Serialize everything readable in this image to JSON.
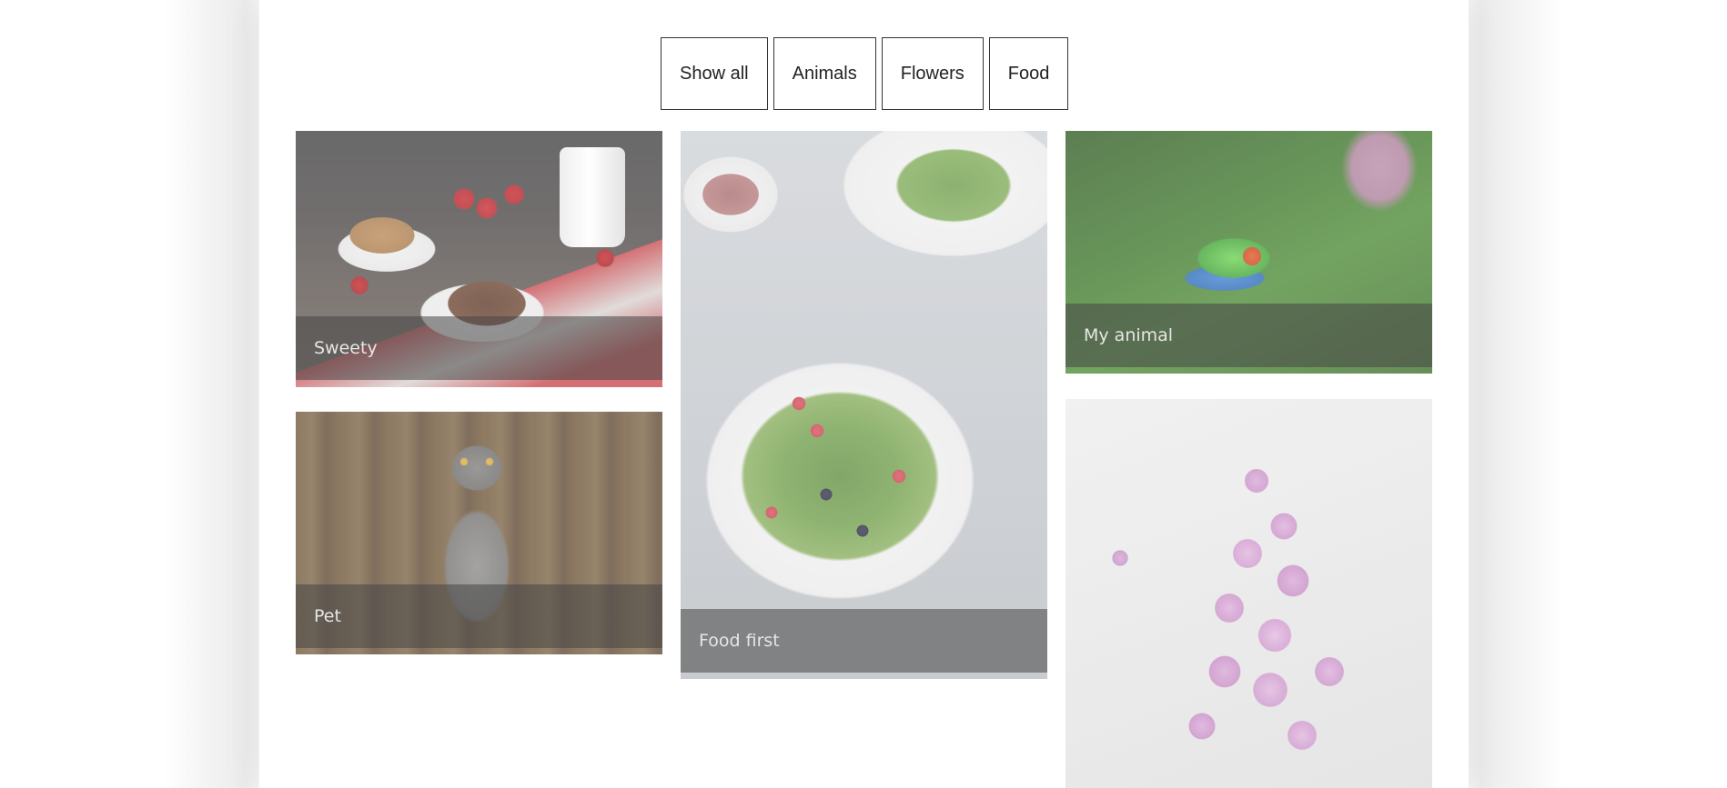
{
  "filters": [
    {
      "label": "Show all"
    },
    {
      "label": "Animals"
    },
    {
      "label": "Flowers"
    },
    {
      "label": "Food"
    }
  ],
  "gallery": {
    "items": [
      {
        "caption": "Sweety"
      },
      {
        "caption": "Food first"
      },
      {
        "caption": "My animal"
      },
      {
        "caption": "Pet"
      }
    ]
  }
}
